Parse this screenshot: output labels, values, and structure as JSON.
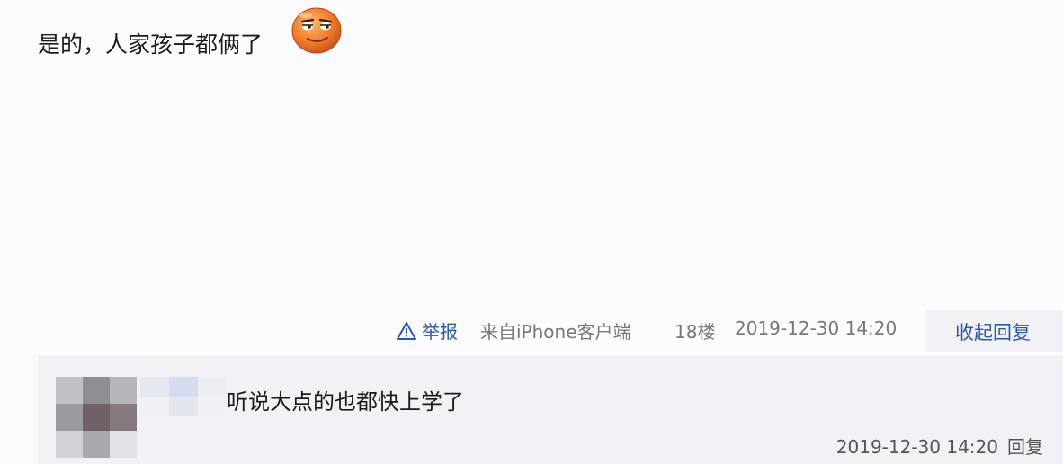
{
  "post": {
    "text": "是的，人家孩子都俩了",
    "emoji_icon": "smirk-face-emoji"
  },
  "meta": {
    "report_icon": "warning-triangle-icon",
    "report_label": "举报",
    "source": "来自iPhone客户端",
    "floor": "18楼",
    "time": "2019-12-30 14:20",
    "collapse_label": "收起回复"
  },
  "reply": {
    "text": "听说大点的也都快上学了",
    "time": "2019-12-30 14:20",
    "reply_label": "回复"
  },
  "colors": {
    "link": "#2b5aa8",
    "muted": "#777777",
    "reply_bg": "#f1f1f6",
    "emoji_orange": "#f07a2a"
  }
}
